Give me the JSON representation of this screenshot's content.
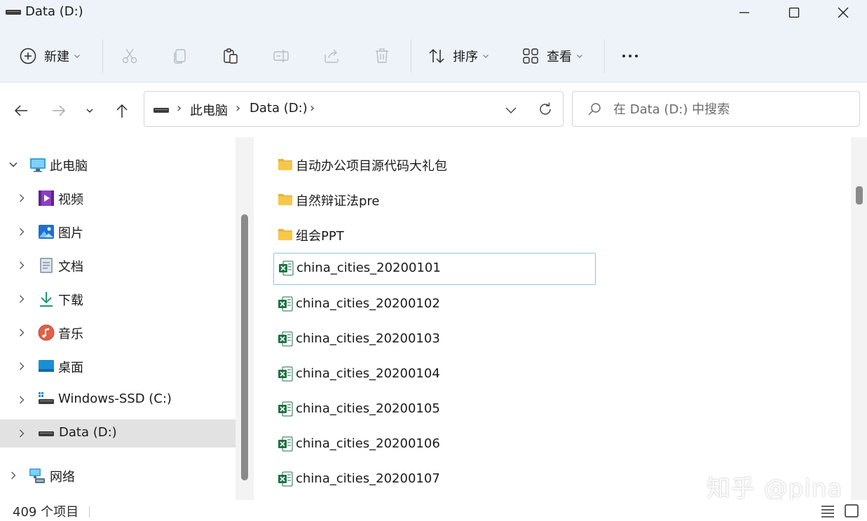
{
  "window": {
    "title": "Data (D:)"
  },
  "toolbar": {
    "new_label": "新建",
    "sort_label": "排序",
    "view_label": "查看"
  },
  "address": {
    "crumbs": [
      "此电脑",
      "Data (D:)"
    ],
    "search_placeholder": "在 Data (D:) 中搜索"
  },
  "nav": {
    "items": [
      {
        "label": "此电脑",
        "icon": "computer-icon"
      },
      {
        "label": "视频",
        "icon": "video-icon"
      },
      {
        "label": "图片",
        "icon": "pictures-icon"
      },
      {
        "label": "文档",
        "icon": "documents-icon"
      },
      {
        "label": "下载",
        "icon": "download-icon"
      },
      {
        "label": "音乐",
        "icon": "music-icon"
      },
      {
        "label": "桌面",
        "icon": "desktop-icon"
      },
      {
        "label": "Windows-SSD (C:)",
        "icon": "drive-icon"
      },
      {
        "label": "Data (D:)",
        "icon": "drive-icon"
      },
      {
        "label": "网络",
        "icon": "network-icon"
      }
    ]
  },
  "files": [
    {
      "name": "自动办公项目源代码大礼包",
      "type": "folder"
    },
    {
      "name": "自然辩证法pre",
      "type": "folder"
    },
    {
      "name": "组会PPT",
      "type": "folder"
    },
    {
      "name": "china_cities_20200101",
      "type": "excel"
    },
    {
      "name": "china_cities_20200102",
      "type": "excel"
    },
    {
      "name": "china_cities_20200103",
      "type": "excel"
    },
    {
      "name": "china_cities_20200104",
      "type": "excel"
    },
    {
      "name": "china_cities_20200105",
      "type": "excel"
    },
    {
      "name": "china_cities_20200106",
      "type": "excel"
    },
    {
      "name": "china_cities_20200107",
      "type": "excel"
    }
  ],
  "status": {
    "item_count": "409 个项目"
  },
  "watermark": "知乎 @pina",
  "colors": {
    "chrome_bg": "#eef3f9",
    "selected_bg": "#e2e2e2",
    "focus_border": "#8ec8da",
    "folder": "#f8c74a",
    "excel": "#1e7145"
  }
}
